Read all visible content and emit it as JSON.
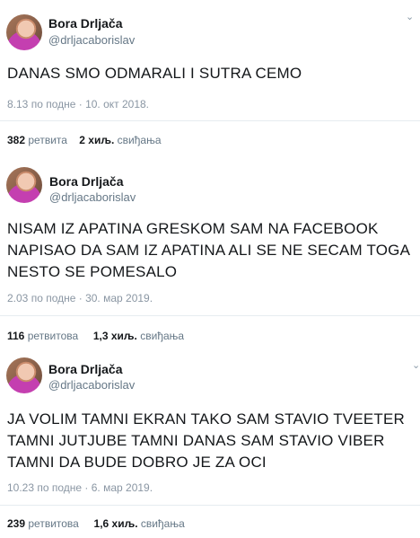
{
  "tweets": [
    {
      "author": "Bora Drljača",
      "handle": "@drljacaborislav",
      "text": "DANAS SMO ODMARALI I SUTRA CEMO",
      "timestamp": "8.13 по подне · 10. окт 2018.",
      "retweets": "382",
      "retweets_label": "ретвита",
      "likes": "2 хиљ.",
      "likes_label": "свиђања"
    },
    {
      "author": "Bora Drljača",
      "handle": "@drljacaborislav",
      "text": "NISAM IZ APATINA GRESKOM SAM NA FACEBOOK\nNAPISAO DA SAM IZ APATINA ALI SE NE SECAM TOGA\nNESTO SE POMESALO",
      "timestamp": "2.03 по подне · 30. мар 2019.",
      "retweets": "116",
      "retweets_label": "ретвитова",
      "likes": "1,3 хиљ.",
      "likes_label": "свиђања"
    },
    {
      "author": "Bora Drljača",
      "handle": "@drljacaborislav",
      "text": "JA VOLIM TAMNI EKRAN TAKO SAM STAVIO TVEETER\nTAMNI JUTJUBE TAMNI DANAS SAM STAVIO VIBER\nTAMNI DA BUDE DOBRO JE ZA OCI",
      "timestamp": "10.23 по подне · 6. мар 2019.",
      "retweets": "239",
      "retweets_label": "ретвитова",
      "likes": "1,6 хиљ.",
      "likes_label": "свиђања"
    }
  ],
  "icons": {
    "more": "chevron-down-icon"
  }
}
